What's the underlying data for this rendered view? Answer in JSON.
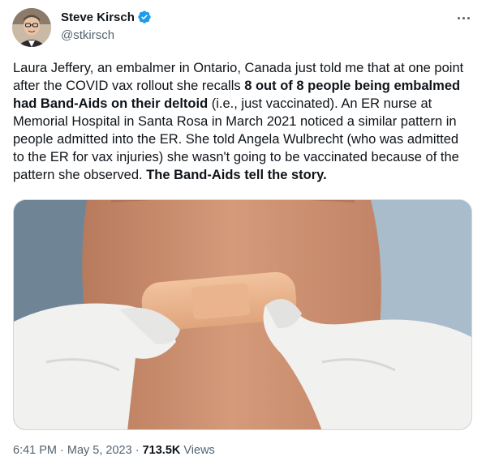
{
  "author": {
    "display_name": "Steve Kirsch",
    "handle": "@stkirsch",
    "verified": true,
    "verified_color": "#1d9bf0"
  },
  "tweet": {
    "text_1": "Laura Jeffery, an embalmer in Ontario, Canada just told me that at one point after the COVID vax rollout she recalls ",
    "bold_1": "8 out of 8 people being embalmed had Band-Aids on their deltoid",
    "text_2": " (i.e., just vaccinated). An ER nurse at Memorial Hospital in Santa Rosa in March 2021 noticed a similar pattern in people admitted into the ER. She told Angela Wulbrecht (who was admitted to the ER for vax injuries) she wasn't going to be vaccinated because of the pattern she observed. ",
    "bold_2": "The Band-Aids tell the story."
  },
  "meta": {
    "time": "6:41 PM",
    "sep1": " · ",
    "date": "May 5, 2023",
    "sep2": " · ",
    "views_count": "713.5K",
    "views_label": " Views"
  },
  "icons": {
    "more": "more-horizontal-icon",
    "verified": "verified-badge-icon"
  }
}
